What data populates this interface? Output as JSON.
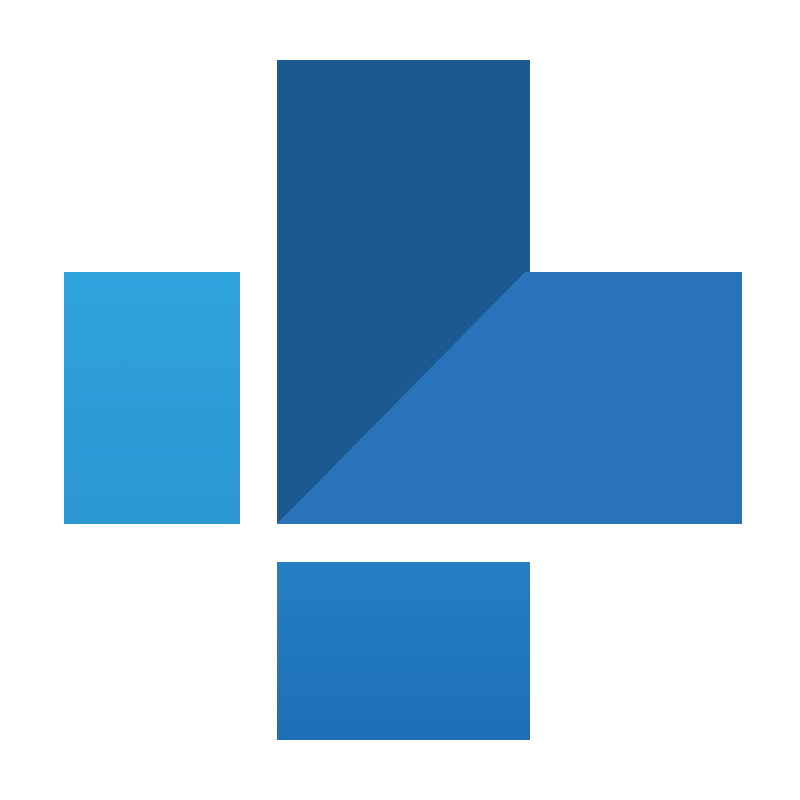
{
  "logo": {
    "icon": "medical-cross-logo-icon",
    "colors": {
      "background": "#ffffff",
      "left_block_top": "#2ea3dc",
      "left_block_bottom": "#2b97d3",
      "upper_block": "#1a5a90",
      "right_block": "#2873b9",
      "lower_block_top": "#2480c3",
      "lower_block_bottom": "#1e6fb5"
    }
  }
}
